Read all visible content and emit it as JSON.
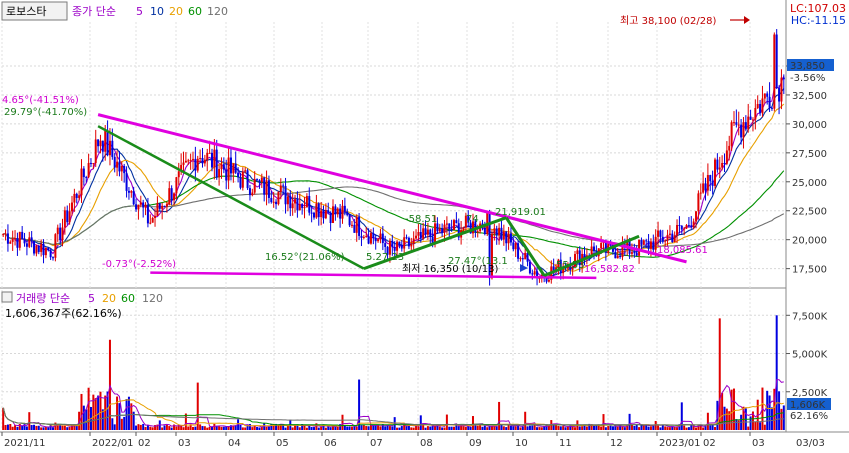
{
  "stock_name": "로보스타",
  "price_legend": {
    "prefix": "종가 단순",
    "periods": [
      "5",
      "10",
      "20",
      "60",
      "120"
    ]
  },
  "volume_legend": {
    "prefix": "거래량 단순",
    "periods": [
      "5",
      "20",
      "60",
      "120"
    ]
  },
  "colors": {
    "ma5": "#9c00c8",
    "ma10": "#0030a0",
    "ma20": "#e8a000",
    "ma60": "#009000",
    "ma120": "#707070",
    "up": "#e00000",
    "down": "#0000e0",
    "trend_magenta": "#e000e0",
    "trend_green": "#1a8c1a"
  },
  "top_right": {
    "lc": "LC:107.03",
    "hc": "HC:-11.15"
  },
  "current_price": {
    "label": "33,850",
    "pct": "-3.56%"
  },
  "volume_current": {
    "label": "1,606K",
    "pct": "62.16%"
  },
  "volume_header": "1,606,367주(62.16%)",
  "annotations": {
    "high": "최고 38,100 (02/28)",
    "low": "최저 16,350 (10/13)",
    "a1": "4.65°(-41.51%)",
    "a2": "29.79°(-41.70%)",
    "a3": "-0.73°(-2.52%)",
    "a4": "16.52°(21.06%)",
    "a5": "5.27.23",
    "a6": "-58.51",
    "a7": "74",
    "a8": "21,919.01",
    "a9": "27.47°(13.1",
    "a10": "55.53",
    "a11": "16,582.82",
    "a12": "18,085.61"
  },
  "chart_data": {
    "type": "candlestick",
    "title": "로보스타",
    "x_ticks": [
      "2021/11",
      "2022/01",
      "02",
      "03",
      "04",
      "05",
      "06",
      "07",
      "08",
      "09",
      "10",
      "11",
      "12",
      "2023/01",
      "02",
      "03",
      "03/03"
    ],
    "y_price_ticks": [
      "35,000",
      "32,500",
      "30,000",
      "27,500",
      "25,000",
      "22,500",
      "20,000",
      "17,500"
    ],
    "y_price_values": [
      35000,
      32500,
      30000,
      27500,
      25000,
      22500,
      20000,
      17500
    ],
    "y_price_range": [
      16000,
      38800
    ],
    "y_volume_ticks": [
      "7,500K",
      "5,000K",
      "2,500K"
    ],
    "y_volume_values": [
      7500,
      5000,
      2500
    ],
    "y_volume_range": [
      0,
      8500
    ],
    "price_series": [
      {
        "t": "2021/11",
        "close": 20500
      },
      {
        "t": "2021/12",
        "close": 19000
      },
      {
        "t": "2022/01",
        "close": 29000
      },
      {
        "t": "2022/02",
        "close": 21500
      },
      {
        "t": "2022/03",
        "close": 27500
      },
      {
        "t": "2022/04",
        "close": 25000
      },
      {
        "t": "2022/05",
        "close": 23500
      },
      {
        "t": "2022/06",
        "close": 22000
      },
      {
        "t": "2022/07",
        "close": 19000
      },
      {
        "t": "2022/08",
        "close": 20800
      },
      {
        "t": "2022/09",
        "close": 21500
      },
      {
        "t": "2022/10",
        "close": 16800
      },
      {
        "t": "2022/11",
        "close": 19000
      },
      {
        "t": "2022/12",
        "close": 19200
      },
      {
        "t": "2023/01",
        "close": 21000
      },
      {
        "t": "2023/02",
        "close": 29500
      },
      {
        "t": "2023/03",
        "close": 33850
      }
    ],
    "high": {
      "value": 38100,
      "date": "02/28"
    },
    "low": {
      "value": 16350,
      "date": "10/13"
    },
    "current": 33850
  }
}
